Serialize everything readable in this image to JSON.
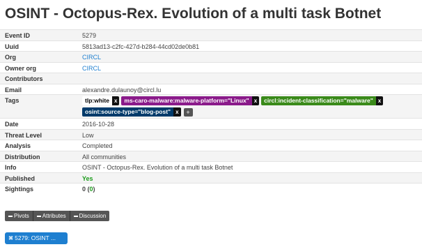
{
  "title": "OSINT - Octopus-Rex. Evolution of a multi task Botnet",
  "fields": [
    {
      "key": "Event ID",
      "value": "5279"
    },
    {
      "key": "Uuid",
      "value": "5813ad13-c2fc-427d-b284-44cd02de0b81"
    },
    {
      "key": "Org",
      "value": "CIRCL"
    },
    {
      "key": "Owner org",
      "value": "CIRCL"
    },
    {
      "key": "Contributors",
      "value": ""
    },
    {
      "key": "Email",
      "value": "alexandre.dulaunoy@circl.lu"
    },
    {
      "key": "Tags",
      "value": ""
    },
    {
      "key": "Date",
      "value": "2016-10-28"
    },
    {
      "key": "Threat Level",
      "value": "Low"
    },
    {
      "key": "Analysis",
      "value": "Completed"
    },
    {
      "key": "Distribution",
      "value": "All communities"
    },
    {
      "key": "Info",
      "value": "OSINT - Octopus-Rex. Evolution of a multi task Botnet"
    },
    {
      "key": "Published",
      "value": "Yes"
    },
    {
      "key": "Sightings",
      "value": "0",
      "value_paren": "0"
    }
  ],
  "tags": [
    {
      "label": "tlp:white",
      "bg": "#ffffff",
      "fg": "#000000",
      "remove": "x"
    },
    {
      "label": "ms-caro-malware:malware-platform=\"Linux\"",
      "bg": "#8a1a8a",
      "fg": "#ffffff",
      "remove": "x"
    },
    {
      "label": "circl:incident-classification=\"malware\"",
      "bg": "#3a8a1a",
      "fg": "#ffffff",
      "remove": "x"
    },
    {
      "label": "osint:source-type=\"blog-post\"",
      "bg": "#003a6a",
      "fg": "#ffffff",
      "remove": "x"
    }
  ],
  "add_tag": "+",
  "buttons": [
    "Pivots",
    "Attributes",
    "Discussion"
  ],
  "event_chip": "5279: OSINT ..."
}
